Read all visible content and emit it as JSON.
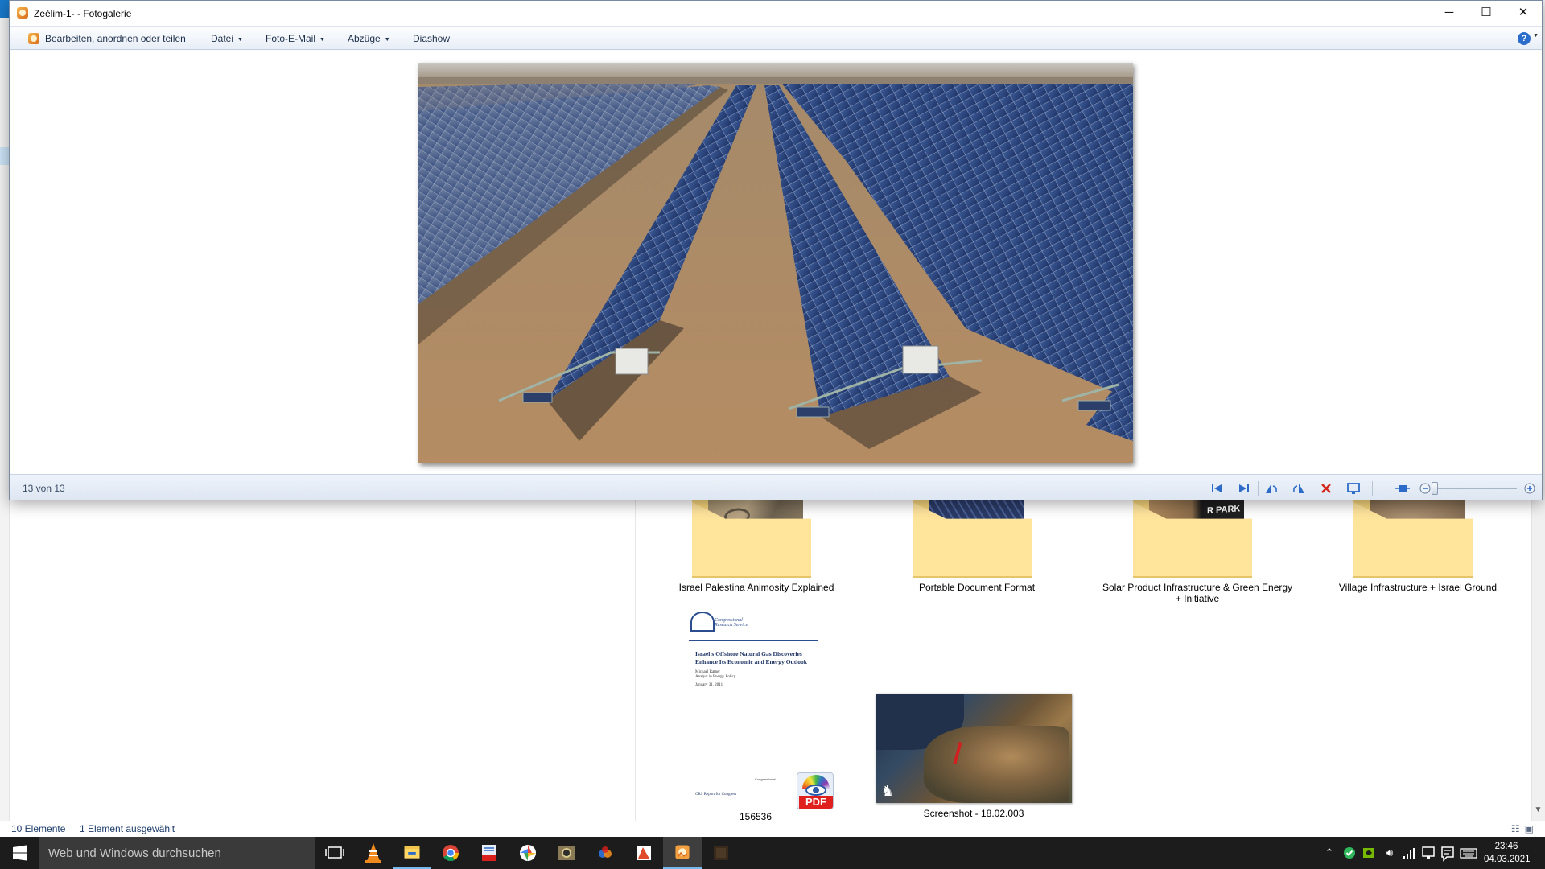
{
  "gallery": {
    "window_title": "Zeélim-1- - Fotogalerie",
    "menu": {
      "edit": "Bearbeiten, anordnen oder teilen",
      "file": "Datei",
      "email": "Foto-E-Mail",
      "prints": "Abzüge",
      "slideshow": "Diashow",
      "help": "?"
    },
    "controls": {
      "minimize": "─",
      "maximize": "☐",
      "close": "✕"
    },
    "counter": "13 von 13",
    "toolbar_icons": [
      "first-photo-icon",
      "last-photo-icon",
      "rotate-left-icon",
      "rotate-right-icon",
      "delete-icon",
      "display-icon",
      "fit-window-icon",
      "zoom-out-icon",
      "zoom-in-icon"
    ],
    "zoom_level": 0.0
  },
  "explorer": {
    "folders": [
      {
        "label": "Israel Palestina Animosity Explained"
      },
      {
        "label": "Portable Document Format"
      },
      {
        "label": "Solar Product Infrastructure & Green Energy + Initiative"
      },
      {
        "label": "Village Infrastructure + Israel Ground"
      }
    ],
    "park_overlay": "R PARK",
    "doc_thumb": {
      "seal_text": "Congressional Research Service",
      "title": "Israel's Offshore Natural Gas Discoveries Enhance Its Economic and Energy Outlook",
      "author": "Michael Ratner",
      "role": "Analyst in Energy Policy",
      "date": "January 31, 2011"
    },
    "pdf_file": {
      "label": "156536",
      "mini_header": "Congressional",
      "mini_title": "CRS Report for Congress",
      "badge": "PDF"
    },
    "screenshot_file": {
      "label": "Screenshot - 18.02.003"
    },
    "status": {
      "count": "10 Elemente",
      "selected": "1 Element ausgewählt"
    }
  },
  "taskbar": {
    "search_placeholder": "Web und Windows durchsuchen",
    "pinned": [
      "task-view-icon",
      "vlc-icon",
      "file-explorer-icon",
      "chrome-icon",
      "pdf-viewer-icon",
      "picasa-icon",
      "photo-viewer-icon",
      "xara-icon",
      "office-icon",
      "photo-gallery-icon",
      "dark-app-icon"
    ],
    "time": "23:46",
    "date": "04.03.2021"
  },
  "colors": {
    "accent": "#76b9ed",
    "taskbar": "#1c1c1c",
    "folder": "#ffe49c",
    "status_text": "#1a3a6a"
  }
}
